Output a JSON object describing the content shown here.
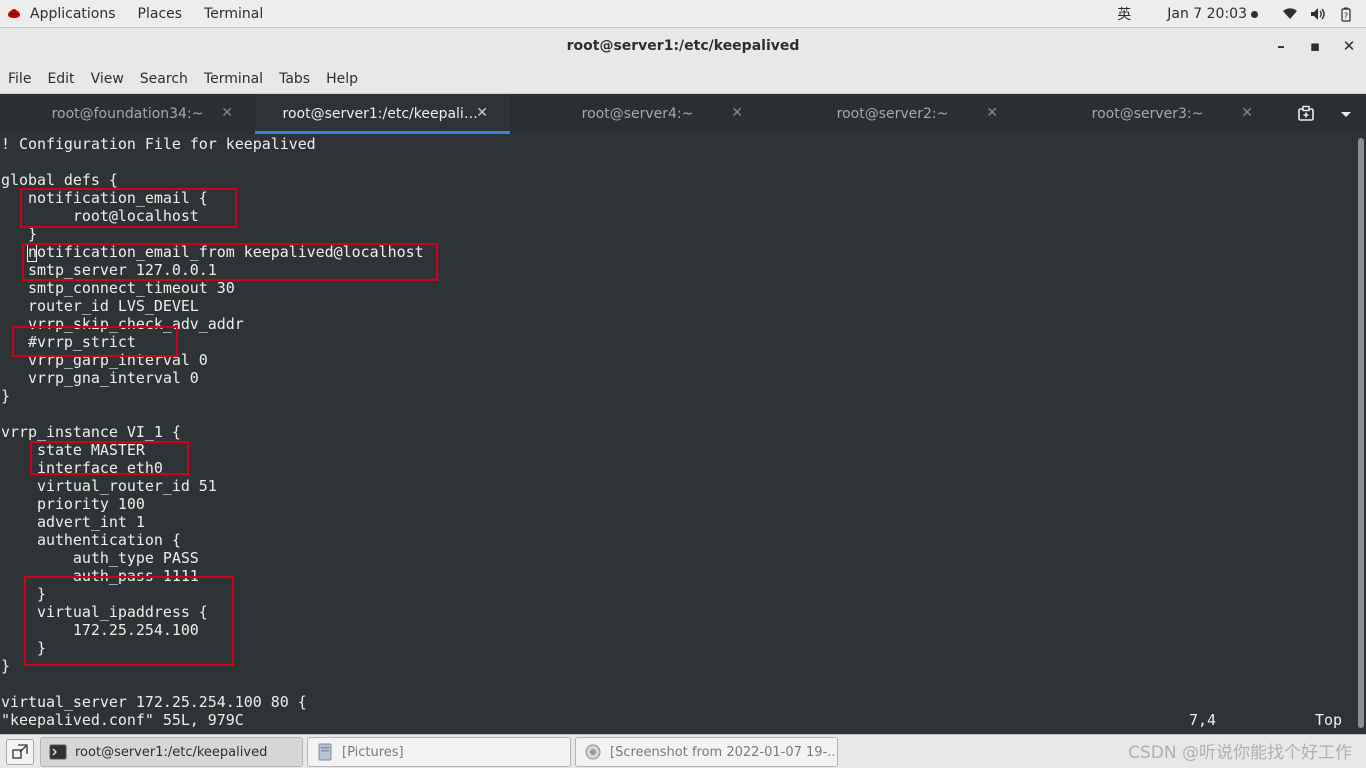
{
  "topbar": {
    "applications": "Applications",
    "places": "Places",
    "terminal": "Terminal",
    "input_method": "英",
    "clock": "Jan 7  20:03",
    "icons": [
      "network-wifi-icon",
      "volume-icon",
      "battery-icon"
    ]
  },
  "window": {
    "title": "root@server1:/etc/keepalived",
    "minimize": "–",
    "maximize": "▪",
    "close": "✕"
  },
  "menu": [
    "File",
    "Edit",
    "View",
    "Search",
    "Terminal",
    "Tabs",
    "Help"
  ],
  "tabs": [
    {
      "label": "root@foundation34:~",
      "active": false
    },
    {
      "label": "root@server1:/etc/keepaliv...",
      "active": true
    },
    {
      "label": "root@server4:~",
      "active": false
    },
    {
      "label": "root@server2:~",
      "active": false
    },
    {
      "label": "root@server3:~",
      "active": false
    }
  ],
  "tab_close_glyph": "✕",
  "terminal": {
    "lines": [
      "! Configuration File for keepalived",
      "",
      "global_defs {",
      "   notification_email {",
      "        root@localhost",
      "   }",
      "   notification_email_from keepalived@localhost",
      "   smtp_server 127.0.0.1",
      "   smtp_connect_timeout 30",
      "   router_id LVS_DEVEL",
      "   vrrp_skip_check_adv_addr",
      "   #vrrp_strict",
      "   vrrp_garp_interval 0",
      "   vrrp_gna_interval 0",
      "}",
      "",
      "vrrp_instance VI_1 {",
      "    state MASTER",
      "    interface eth0",
      "    virtual_router_id 51",
      "    priority 100",
      "    advert_int 1",
      "    authentication {",
      "        auth_type PASS",
      "        auth_pass 1111",
      "    }",
      "    virtual_ipaddress {",
      "        172.25.254.100",
      "    }",
      "}",
      "",
      "virtual_server 172.25.254.100 80 {",
      "\"keepalived.conf\" 55L, 979C"
    ],
    "cursor_position": "7,4",
    "scroll_position": "Top"
  },
  "taskbar": {
    "items": [
      {
        "label": "root@server1:/etc/keepalived",
        "active": true
      },
      {
        "label": "[Pictures]",
        "active": false
      },
      {
        "label": "[Screenshot from 2022-01-07 19-...",
        "active": false
      }
    ],
    "watermark": "CSDN @听说你能找个好工作"
  },
  "colors": {
    "terminal_bg": "#2e3436",
    "terminal_fg": "#eeeeec",
    "highlight_box": "#d0021b",
    "active_tab_indicator": "#3584e4"
  }
}
